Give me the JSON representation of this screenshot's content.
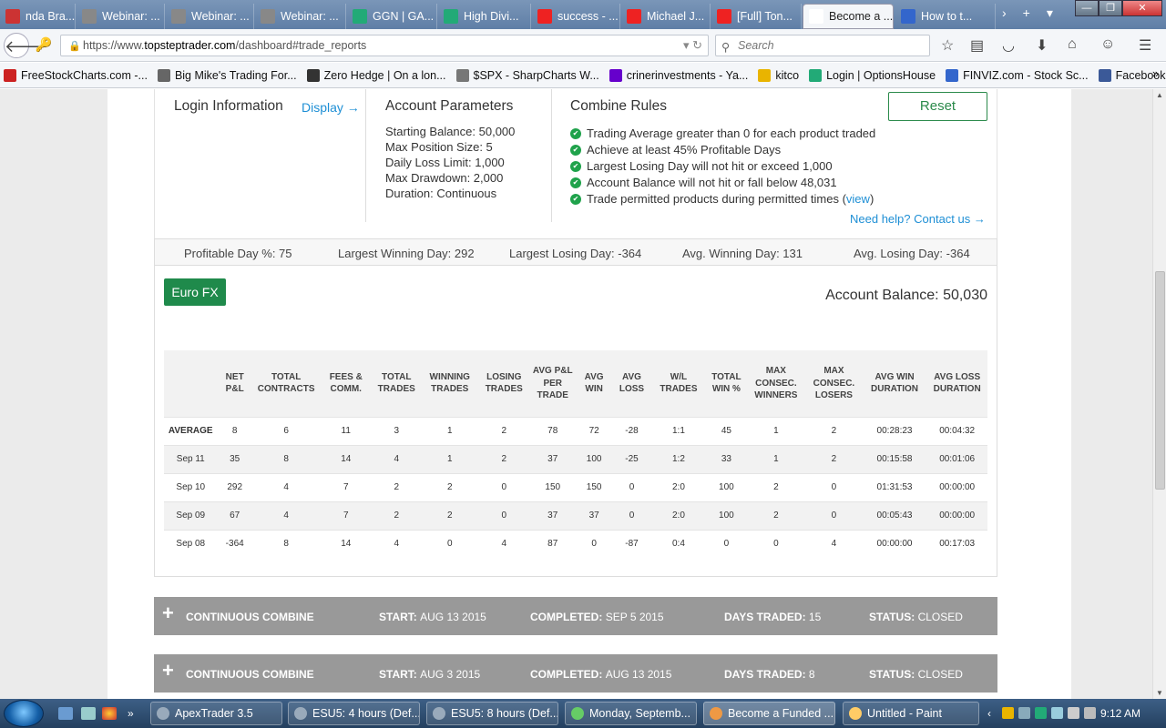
{
  "browser": {
    "tabs": [
      {
        "label": "nda Bra...",
        "icon_color": "#c33"
      },
      {
        "label": "Webinar: ...",
        "icon_color": "#888"
      },
      {
        "label": "Webinar: ...",
        "icon_color": "#888"
      },
      {
        "label": "Webinar: ...",
        "icon_color": "#888"
      },
      {
        "label": "GGN | GA...",
        "icon_color": "#2a7"
      },
      {
        "label": "High Divi...",
        "icon_color": "#2a7"
      },
      {
        "label": "success - ...",
        "icon_color": "#e22"
      },
      {
        "label": "Michael J...",
        "icon_color": "#e22"
      },
      {
        "label": "[Full] Ton...",
        "icon_color": "#e22"
      },
      {
        "label": "Become a ...",
        "icon_color": "#fff"
      },
      {
        "label": "How to t...",
        "icon_color": "#36c"
      }
    ],
    "tab_close": "✕",
    "new_tab": "+",
    "url": {
      "prefix": "https://www.",
      "host": "topsteptrader.com",
      "path": "/dashboard#trade_reports"
    },
    "search_placeholder": "Search",
    "bookmarks": [
      {
        "label": "FreeStockCharts.com -...",
        "icon_color": "#c22"
      },
      {
        "label": "Big Mike's Trading For...",
        "icon_color": "#666"
      },
      {
        "label": "Zero Hedge | On a lon...",
        "icon_color": "#333"
      },
      {
        "label": "$SPX - SharpCharts W...",
        "icon_color": "#777"
      },
      {
        "label": "crinerinvestments - Ya...",
        "icon_color": "#60c"
      },
      {
        "label": "kitco",
        "icon_color": "#e9b400"
      },
      {
        "label": "Login | OptionsHouse",
        "icon_color": "#2a7"
      },
      {
        "label": "FINVIZ.com - Stock Sc...",
        "icon_color": "#36c"
      },
      {
        "label": "Facebook logo",
        "icon_color": "#3b5998"
      }
    ]
  },
  "dashboard": {
    "login_title": "Login Information",
    "display_link": "Display →",
    "params_title": "Account Parameters",
    "params": [
      "Starting Balance: 50,000",
      "Max Position Size: 5",
      "Daily Loss Limit: 1,000",
      "Max Drawdown: 2,000",
      "Duration: Continuous"
    ],
    "rules_title": "Combine Rules",
    "rules": [
      "Trading Average greater than 0 for each product traded",
      "Achieve at least 45% Profitable Days",
      "Largest Losing Day will not hit or exceed 1,000",
      "Account Balance will not hit or fall below 48,031"
    ],
    "rule_last_prefix": "Trade permitted products during permitted times (",
    "rule_last_link": "view",
    "rule_last_suffix": ")",
    "reset_label": "Reset",
    "help_link": "Need help? Contact us →",
    "stats": [
      "Profitable Day %: 75",
      "Largest Winning Day: 292",
      "Largest Losing Day: -364",
      "Avg. Winning Day: 131",
      "Avg. Losing Day: -364"
    ],
    "product_button": "Euro FX",
    "account_balance": "Account Balance: 50,030",
    "table": {
      "headers": [
        "",
        "NET P&L",
        "TOTAL CONTRACTS",
        "FEES & COMM.",
        "TOTAL TRADES",
        "WINNING TRADES",
        "LOSING TRADES",
        "AVG P&L PER TRADE",
        "AVG WIN",
        "AVG LOSS",
        "W/L TRADES",
        "TOTAL WIN %",
        "MAX CONSEC. WINNERS",
        "MAX CONSEC. LOSERS",
        "AVG WIN DURATION",
        "AVG LOSS DURATION"
      ],
      "rows": [
        [
          "AVERAGE",
          "8",
          "6",
          "11",
          "3",
          "1",
          "2",
          "78",
          "72",
          "-28",
          "1:1",
          "45",
          "1",
          "2",
          "00:28:23",
          "00:04:32"
        ],
        [
          "Sep 11",
          "35",
          "8",
          "14",
          "4",
          "1",
          "2",
          "37",
          "100",
          "-25",
          "1:2",
          "33",
          "1",
          "2",
          "00:15:58",
          "00:01:06"
        ],
        [
          "Sep 10",
          "292",
          "4",
          "7",
          "2",
          "2",
          "0",
          "150",
          "150",
          "0",
          "2:0",
          "100",
          "2",
          "0",
          "01:31:53",
          "00:00:00"
        ],
        [
          "Sep 09",
          "67",
          "4",
          "7",
          "2",
          "2",
          "0",
          "37",
          "37",
          "0",
          "2:0",
          "100",
          "2",
          "0",
          "00:05:43",
          "00:00:00"
        ],
        [
          "Sep 08",
          "-364",
          "8",
          "14",
          "4",
          "0",
          "4",
          "87",
          "0",
          "-87",
          "0:4",
          "0",
          "0",
          "4",
          "00:00:00",
          "00:17:03"
        ]
      ]
    },
    "combines": [
      {
        "title": "CONTINUOUS COMBINE",
        "start_label": "START:",
        "start": "AUG 13 2015",
        "completed_label": "COMPLETED:",
        "completed": "SEP 5 2015",
        "days_label": "DAYS TRADED:",
        "days": "15",
        "status_label": "STATUS:",
        "status": "CLOSED"
      },
      {
        "title": "CONTINUOUS COMBINE",
        "start_label": "START:",
        "start": "AUG 3 2015",
        "completed_label": "COMPLETED:",
        "completed": "AUG 13 2015",
        "days_label": "DAYS TRADED:",
        "days": "8",
        "status_label": "STATUS:",
        "status": "CLOSED"
      }
    ]
  },
  "taskbar": {
    "tasks": [
      {
        "label": "ApexTrader 3.5",
        "icon_color": "#9ab"
      },
      {
        "label": "ESU5: 4 hours (Def...",
        "icon_color": "#9ab"
      },
      {
        "label": "ESU5: 8 hours (Def...",
        "icon_color": "#9ab"
      },
      {
        "label": "Monday, Septemb...",
        "icon_color": "#6c6"
      },
      {
        "label": "Become a Funded ...",
        "icon_color": "#e94"
      },
      {
        "label": "Untitled - Paint",
        "icon_color": "#fc6"
      }
    ],
    "time": "9:12 AM"
  }
}
